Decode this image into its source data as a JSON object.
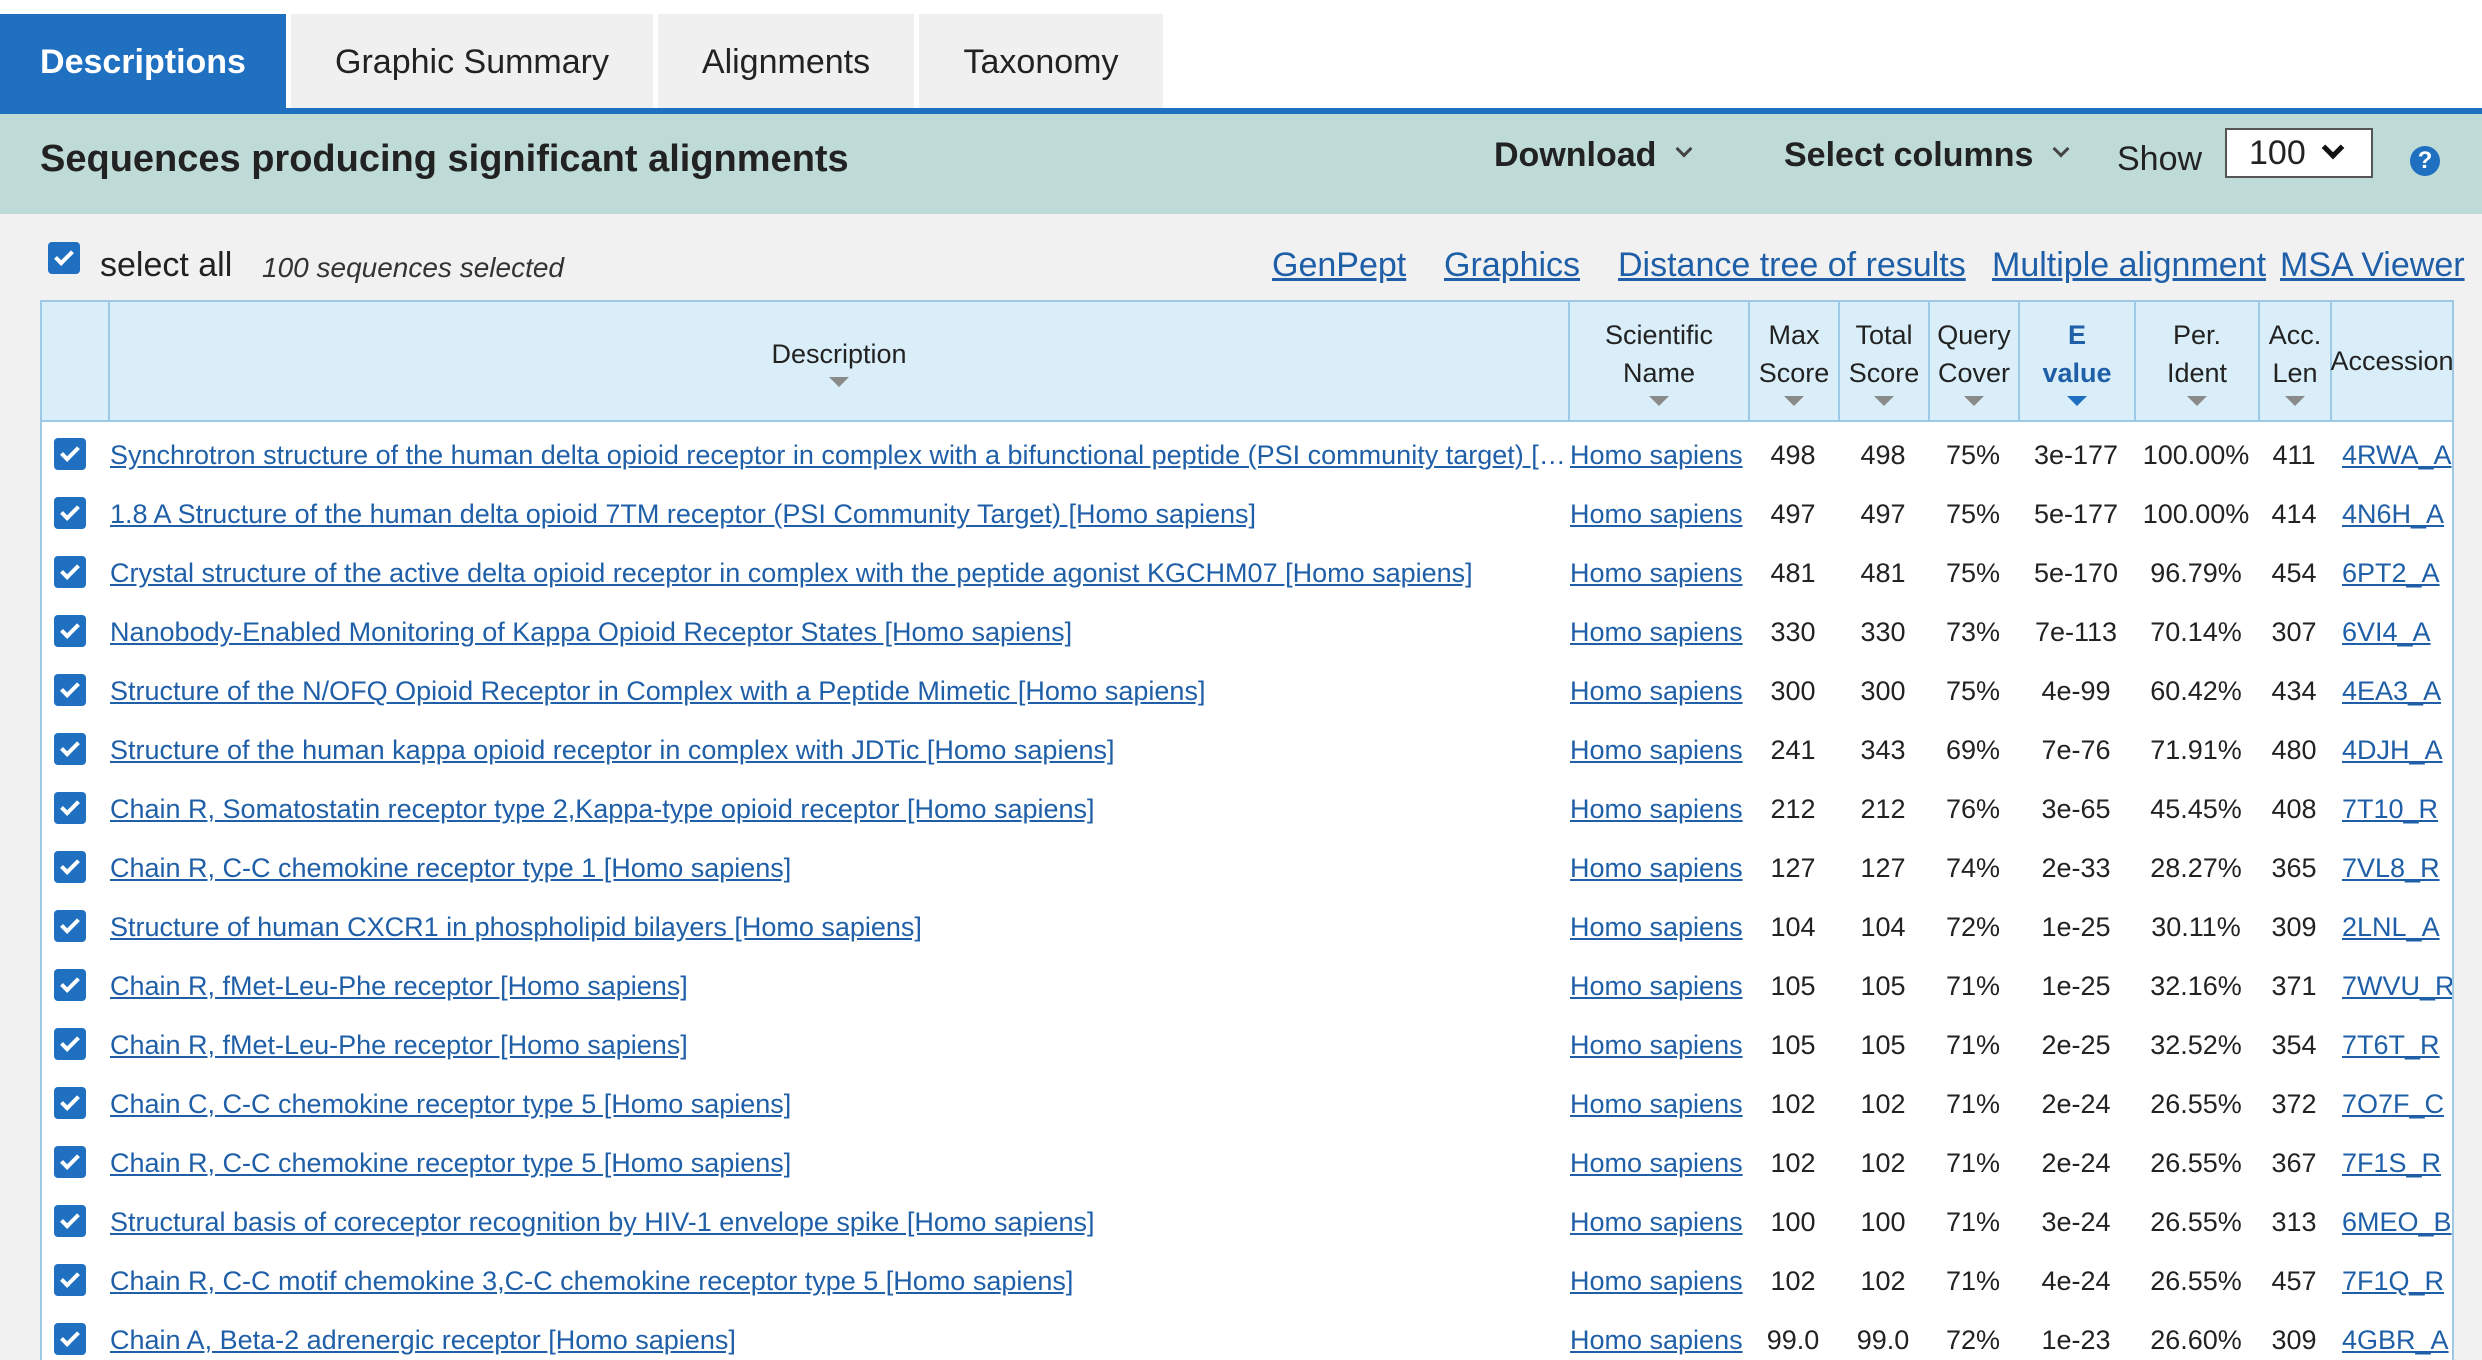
{
  "tabs": [
    {
      "label": "Descriptions"
    },
    {
      "label": "Graphic Summary"
    },
    {
      "label": "Alignments"
    },
    {
      "label": "Taxonomy"
    }
  ],
  "header": {
    "title": "Sequences producing significant alignments",
    "download_label": "Download",
    "select_columns_label": "Select columns",
    "show_label": "Show",
    "show_value": "100",
    "help_icon": "?"
  },
  "toolbar": {
    "select_all_label": "select all",
    "selected_count": "100 sequences selected",
    "links": [
      "GenPept",
      "Graphics",
      "Distance tree of results",
      "Multiple alignment",
      "MSA Viewer"
    ]
  },
  "table": {
    "columns": [
      {
        "line1": "Description",
        "line2": ""
      },
      {
        "line1": "Scientific",
        "line2": "Name"
      },
      {
        "line1": "Max",
        "line2": "Score"
      },
      {
        "line1": "Total",
        "line2": "Score"
      },
      {
        "line1": "Query",
        "line2": "Cover"
      },
      {
        "line1": "E",
        "line2": "value"
      },
      {
        "line1": "Per.",
        "line2": "Ident"
      },
      {
        "line1": "Acc.",
        "line2": "Len"
      },
      {
        "line1": "Accession",
        "line2": ""
      }
    ],
    "rows": [
      {
        "description": "Synchrotron structure of the human delta opioid receptor in complex with a bifunctional peptide (PSI community target) [Homo sapiens]",
        "sci": "Homo sapiens",
        "max": "498",
        "total": "498",
        "cover": "75%",
        "evalue": "3e-177",
        "ident": "100.00%",
        "len": "411",
        "acc": "4RWA_A"
      },
      {
        "description": "1.8 A Structure of the human delta opioid 7TM receptor (PSI Community Target) [Homo sapiens]",
        "sci": "Homo sapiens",
        "max": "497",
        "total": "497",
        "cover": "75%",
        "evalue": "5e-177",
        "ident": "100.00%",
        "len": "414",
        "acc": "4N6H_A"
      },
      {
        "description": "Crystal structure of the active delta opioid receptor in complex with the peptide agonist KGCHM07 [Homo sapiens]",
        "sci": "Homo sapiens",
        "max": "481",
        "total": "481",
        "cover": "75%",
        "evalue": "5e-170",
        "ident": "96.79%",
        "len": "454",
        "acc": "6PT2_A"
      },
      {
        "description": "Nanobody-Enabled Monitoring of Kappa Opioid Receptor States [Homo sapiens]",
        "sci": "Homo sapiens",
        "max": "330",
        "total": "330",
        "cover": "73%",
        "evalue": "7e-113",
        "ident": "70.14%",
        "len": "307",
        "acc": "6VI4_A"
      },
      {
        "description": "Structure of the N/OFQ Opioid Receptor in Complex with a Peptide Mimetic [Homo sapiens]",
        "sci": "Homo sapiens",
        "max": "300",
        "total": "300",
        "cover": "75%",
        "evalue": "4e-99",
        "ident": "60.42%",
        "len": "434",
        "acc": "4EA3_A"
      },
      {
        "description": "Structure of the human kappa opioid receptor in complex with JDTic [Homo sapiens]",
        "sci": "Homo sapiens",
        "max": "241",
        "total": "343",
        "cover": "69%",
        "evalue": "7e-76",
        "ident": "71.91%",
        "len": "480",
        "acc": "4DJH_A"
      },
      {
        "description": "Chain R, Somatostatin receptor type 2,Kappa-type opioid receptor [Homo sapiens]",
        "sci": "Homo sapiens",
        "max": "212",
        "total": "212",
        "cover": "76%",
        "evalue": "3e-65",
        "ident": "45.45%",
        "len": "408",
        "acc": "7T10_R"
      },
      {
        "description": "Chain R, C-C chemokine receptor type 1 [Homo sapiens]",
        "sci": "Homo sapiens",
        "max": "127",
        "total": "127",
        "cover": "74%",
        "evalue": "2e-33",
        "ident": "28.27%",
        "len": "365",
        "acc": "7VL8_R"
      },
      {
        "description": "Structure of human CXCR1 in phospholipid bilayers [Homo sapiens]",
        "sci": "Homo sapiens",
        "max": "104",
        "total": "104",
        "cover": "72%",
        "evalue": "1e-25",
        "ident": "30.11%",
        "len": "309",
        "acc": "2LNL_A"
      },
      {
        "description": "Chain R, fMet-Leu-Phe receptor [Homo sapiens]",
        "sci": "Homo sapiens",
        "max": "105",
        "total": "105",
        "cover": "71%",
        "evalue": "1e-25",
        "ident": "32.16%",
        "len": "371",
        "acc": "7WVU_R"
      },
      {
        "description": "Chain R, fMet-Leu-Phe receptor [Homo sapiens]",
        "sci": "Homo sapiens",
        "max": "105",
        "total": "105",
        "cover": "71%",
        "evalue": "2e-25",
        "ident": "32.52%",
        "len": "354",
        "acc": "7T6T_R"
      },
      {
        "description": "Chain C, C-C chemokine receptor type 5 [Homo sapiens]",
        "sci": "Homo sapiens",
        "max": "102",
        "total": "102",
        "cover": "71%",
        "evalue": "2e-24",
        "ident": "26.55%",
        "len": "372",
        "acc": "7O7F_C"
      },
      {
        "description": "Chain R, C-C chemokine receptor type 5 [Homo sapiens]",
        "sci": "Homo sapiens",
        "max": "102",
        "total": "102",
        "cover": "71%",
        "evalue": "2e-24",
        "ident": "26.55%",
        "len": "367",
        "acc": "7F1S_R"
      },
      {
        "description": "Structural basis of coreceptor recognition by HIV-1 envelope spike [Homo sapiens]",
        "sci": "Homo sapiens",
        "max": "100",
        "total": "100",
        "cover": "71%",
        "evalue": "3e-24",
        "ident": "26.55%",
        "len": "313",
        "acc": "6MEO_B"
      },
      {
        "description": "Chain R, C-C motif chemokine 3,C-C chemokine receptor type 5 [Homo sapiens]",
        "sci": "Homo sapiens",
        "max": "102",
        "total": "102",
        "cover": "71%",
        "evalue": "4e-24",
        "ident": "26.55%",
        "len": "457",
        "acc": "7F1Q_R"
      },
      {
        "description": "Chain A, Beta-2 adrenergic receptor [Homo sapiens]",
        "sci": "Homo sapiens",
        "max": "99.0",
        "total": "99.0",
        "cover": "72%",
        "evalue": "1e-23",
        "ident": "26.60%",
        "len": "309",
        "acc": "4GBR_A"
      }
    ]
  }
}
